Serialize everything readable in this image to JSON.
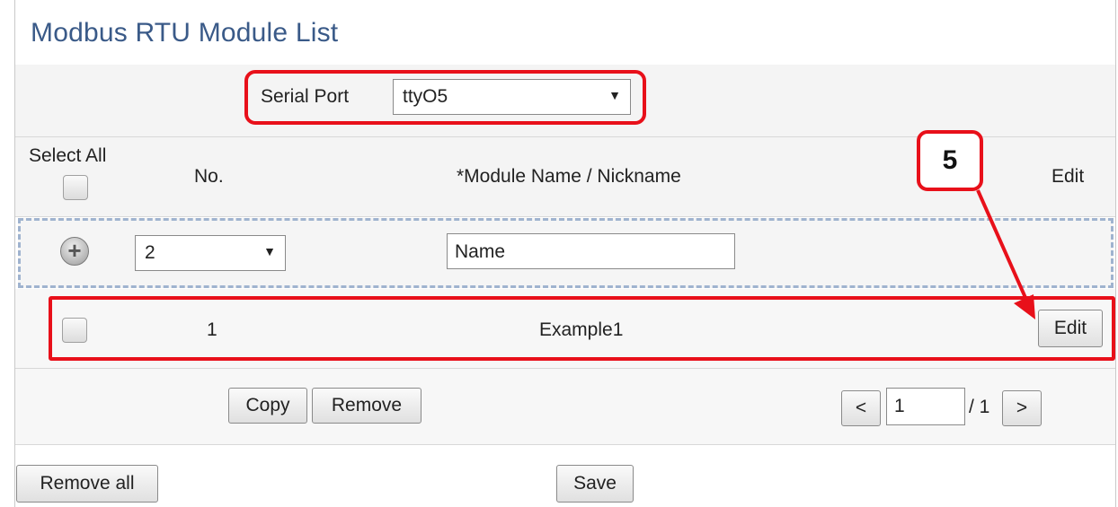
{
  "title": "Modbus RTU Module List",
  "serial_port": {
    "label": "Serial Port",
    "value": "ttyO5"
  },
  "header": {
    "select_all": "Select All",
    "no": "No.",
    "module_name": "*Module Name / Nickname",
    "edit": "Edit"
  },
  "add_row": {
    "number": "2",
    "name_value": "Name"
  },
  "rows": [
    {
      "no": "1",
      "name": "Example1",
      "edit_label": "Edit"
    }
  ],
  "actions": {
    "copy": "Copy",
    "remove": "Remove"
  },
  "pagination": {
    "prev": "<",
    "page": "1",
    "total": "/ 1",
    "next": ">"
  },
  "footer": {
    "remove_all": "Remove all",
    "save": "Save"
  },
  "annotation": {
    "step": "5"
  },
  "colors": {
    "highlight": "#e8101a",
    "title": "#3a5a88",
    "dashed_border": "#9fb3cf"
  }
}
